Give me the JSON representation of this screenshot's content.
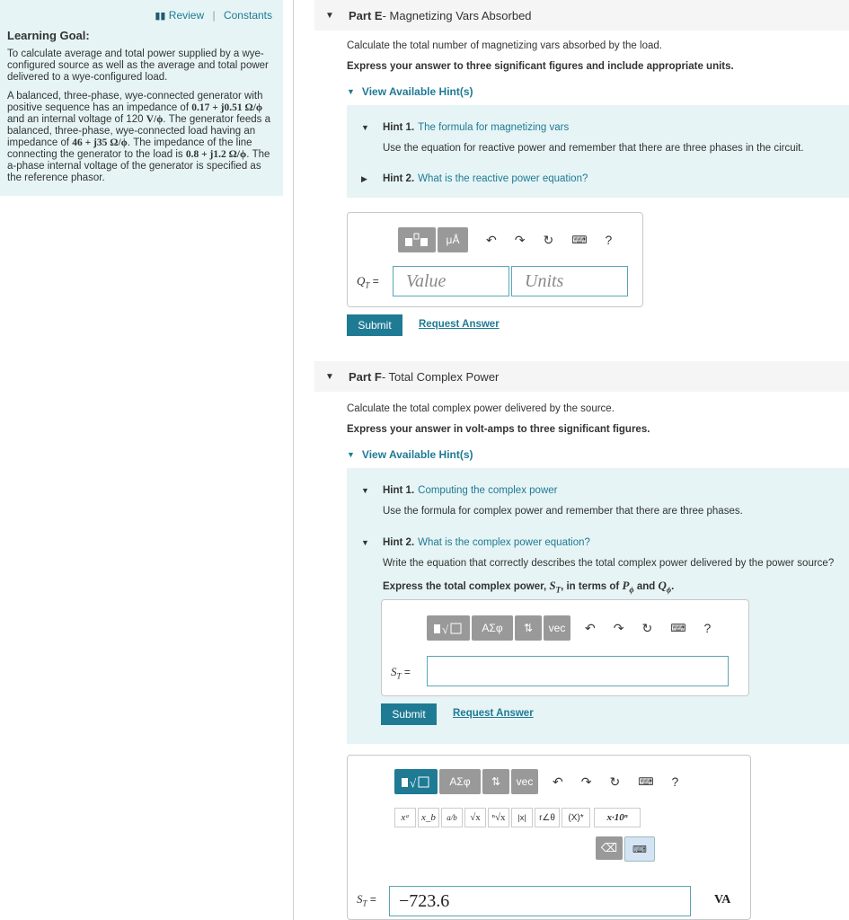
{
  "left": {
    "review_label": "Review",
    "constants_label": "Constants",
    "learning_goal_title": "Learning Goal:",
    "learning_goal_text": "To calculate average and total power supplied by a wye-configured source as well as the average and total power delivered to a wye-configured load.",
    "problem_text_1": "A balanced, three-phase, wye-connected generator with positive sequence has an impedance of ",
    "gen_impedance": "0.17 + j0.51 Ω/ϕ",
    "problem_text_2": " and an internal voltage of 120 ",
    "voltage_unit": "V/ϕ",
    "problem_text_3": ". The generator feeds a balanced, three-phase, wye-connected load having an impedance of ",
    "load_impedance": "46 + j35 Ω/ϕ",
    "problem_text_4": ". The impedance of the line connecting the generator to the load is ",
    "line_impedance": "0.8 + j1.2 Ω/ϕ",
    "problem_text_5": ". The a-phase internal voltage of the generator is specified as the reference phasor."
  },
  "partE": {
    "label": "Part E",
    "title": " - Magnetizing Vars Absorbed",
    "question": "Calculate the total number of magnetizing vars absorbed by the load.",
    "instruction": "Express your answer to three significant figures and include appropriate units.",
    "hints_link": "View Available Hint(s)",
    "hint1_num": "Hint 1.",
    "hint1_title": "The formula for magnetizing vars",
    "hint1_body": "Use the equation for reactive power and remember that there are three phases in the circuit.",
    "hint2_num": "Hint 2.",
    "hint2_title": "What is the reactive power equation?",
    "var_label": "Q",
    "var_sub": "T",
    "equals": " =",
    "value_placeholder": "Value",
    "units_placeholder": "Units",
    "submit": "Submit",
    "request_answer": "Request Answer"
  },
  "partF": {
    "label": "Part F",
    "title": " - Total Complex Power",
    "question": "Calculate the total complex power delivered by the source.",
    "instruction": "Express your answer in volt-amps to three significant figures.",
    "hints_link": "View Available Hint(s)",
    "hint1_num": "Hint 1.",
    "hint1_title": "Computing the complex power",
    "hint1_body": "Use the formula for complex power and remember that there are three phases.",
    "hint2_num": "Hint 2.",
    "hint2_title": "What is the complex power equation?",
    "hint2_body": "Write the equation that correctly describes the total complex power delivered by the power source?",
    "hint2_instr_pre": "Express the total complex power, ",
    "hint2_instr_mid": ", in terms of ",
    "hint2_instr_and": " and ",
    "var_label": "S",
    "var_sub": "T",
    "equals": " =",
    "submit": "Submit",
    "request_answer": "Request Answer",
    "answer_value": "−723.6",
    "answer_units": "VA"
  },
  "toolbar": {
    "mu_a": "μÅ",
    "sigma": "ΑΣφ",
    "arrows": "⇅",
    "vec": "vec",
    "help": "?",
    "xa": "xᵃ",
    "xb": "x_b",
    "frac": "a/b",
    "sqrt": "√x",
    "nroot": "ⁿ√x",
    "abs": "|x|",
    "polar": "r∠θ",
    "conj": "(X)*",
    "sci": "x·10ⁿ"
  }
}
